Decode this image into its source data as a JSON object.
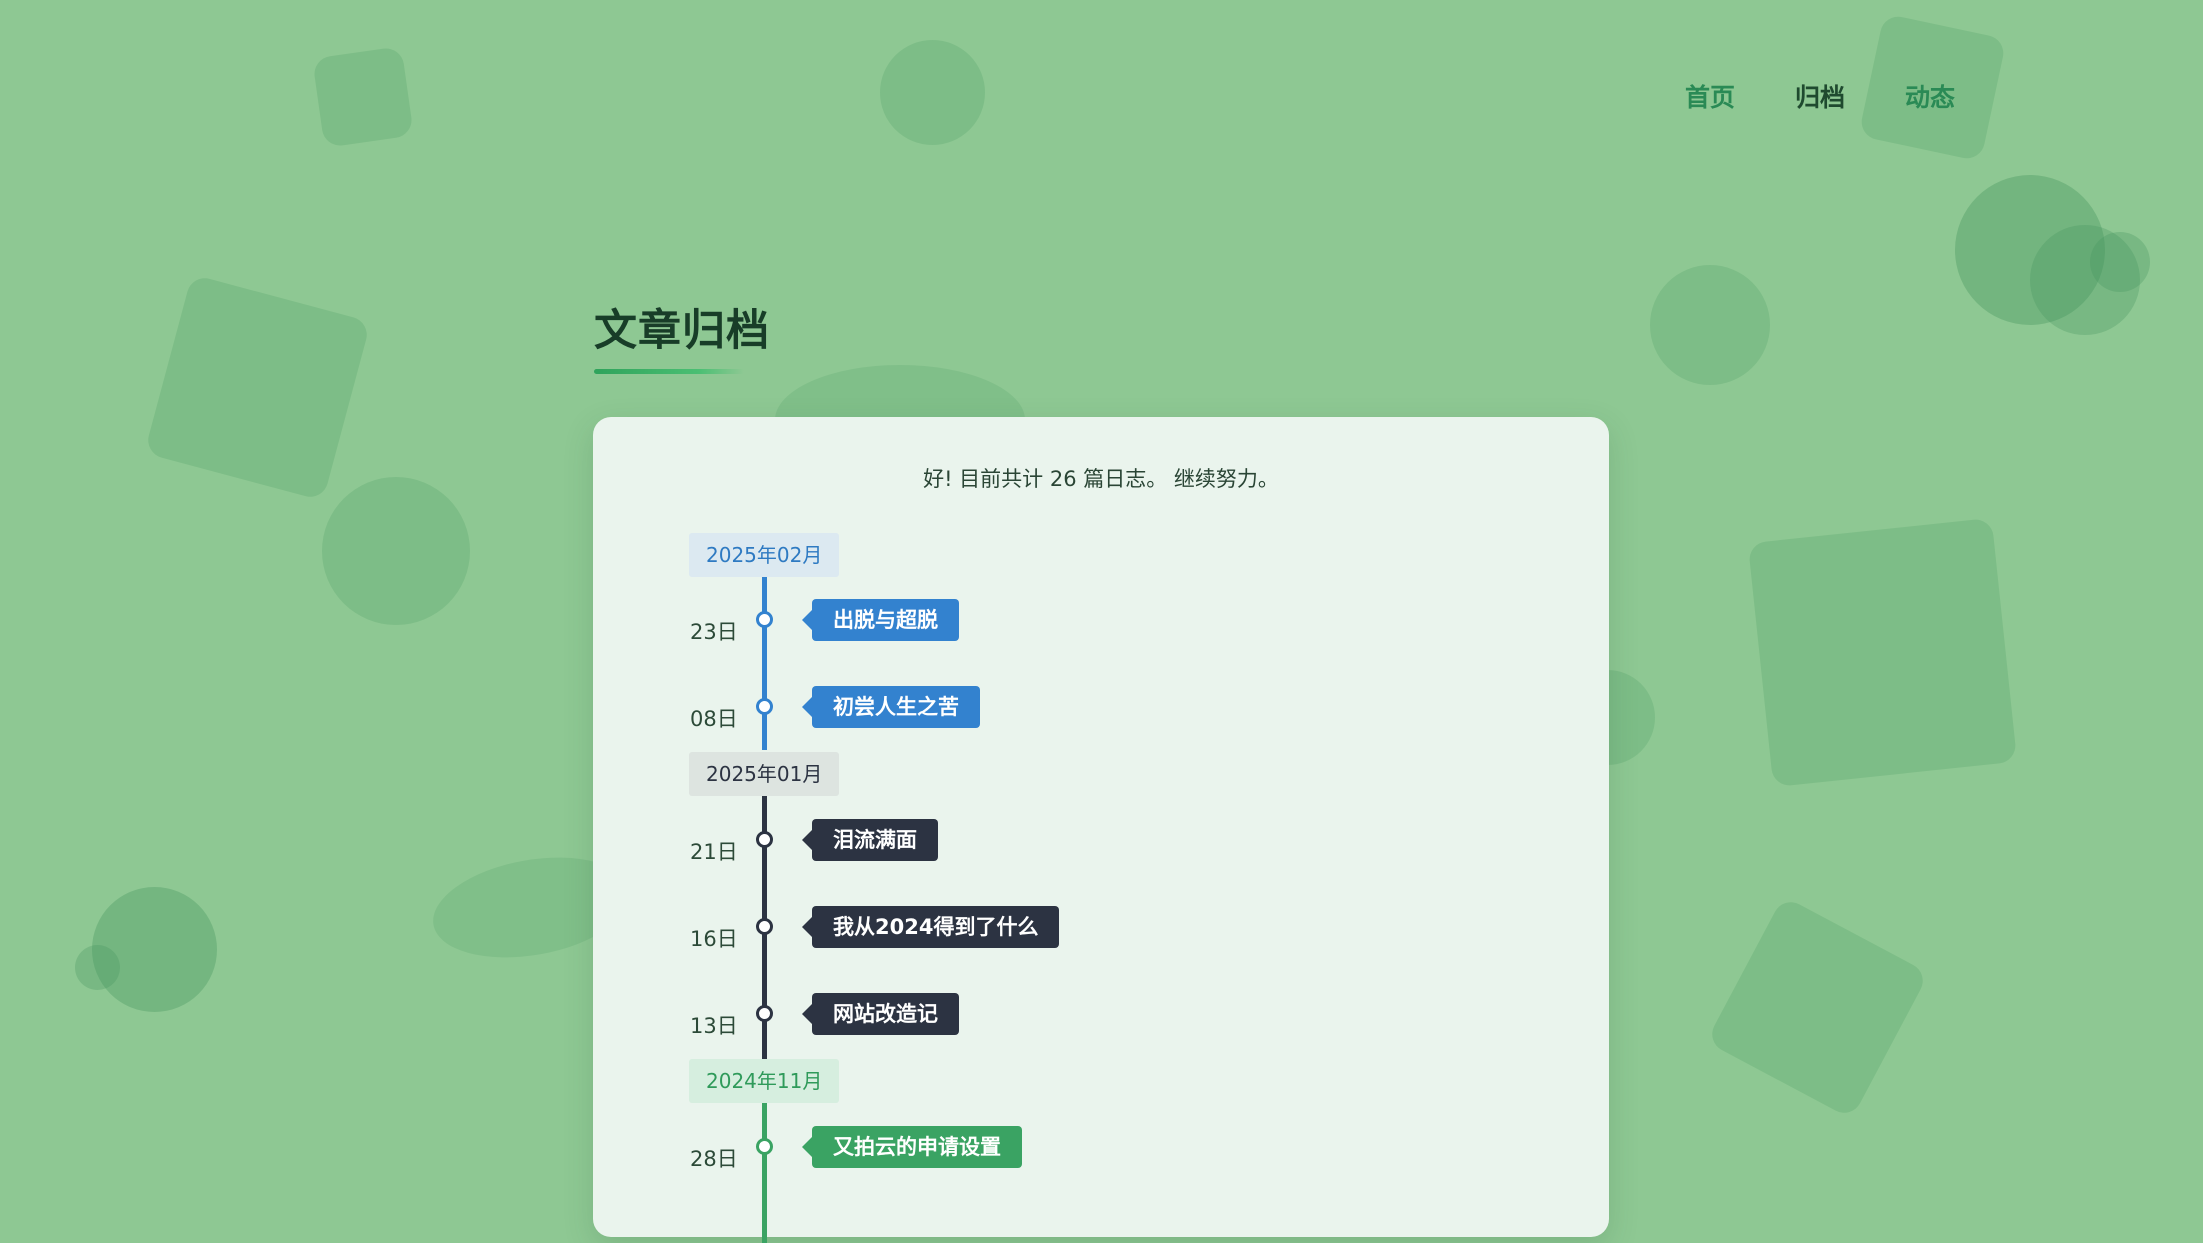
{
  "nav": {
    "items": [
      {
        "label": "首页"
      },
      {
        "label": "归档"
      },
      {
        "label": "动态"
      }
    ]
  },
  "page": {
    "title": "文章归档"
  },
  "archive": {
    "summary": "好! 目前共计 26 篇日志。 继续努力。",
    "groups": [
      {
        "month": "2025年02月",
        "color": "#3382cf",
        "posts": [
          {
            "day": "23日",
            "title": "出脱与超脱"
          },
          {
            "day": "08日",
            "title": "初尝人生之苦"
          }
        ]
      },
      {
        "month": "2025年01月",
        "color": "#2c3342",
        "posts": [
          {
            "day": "21日",
            "title": "泪流满面"
          },
          {
            "day": "16日",
            "title": "我从2024得到了什么"
          },
          {
            "day": "13日",
            "title": "网站改造记"
          }
        ]
      },
      {
        "month": "2024年11月",
        "color": "#3aa363",
        "posts": [
          {
            "day": "28日",
            "title": "又拍云的申请设置"
          }
        ]
      }
    ]
  }
}
